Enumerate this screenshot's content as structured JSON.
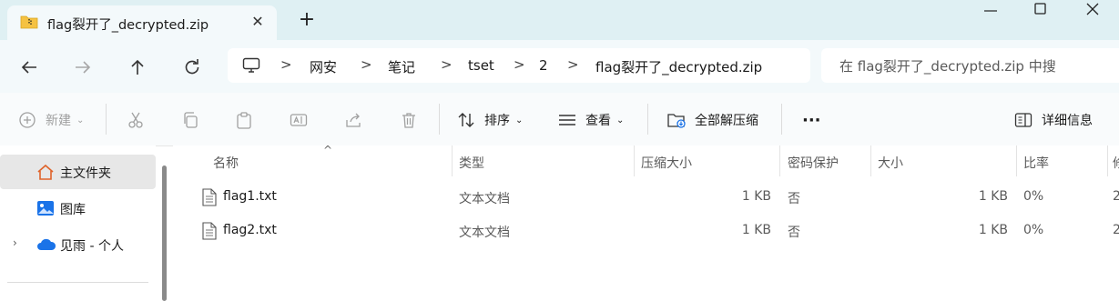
{
  "window": {
    "tab_title": "flag裂开了_decrypted.zip",
    "new_tab_label": "+",
    "close_tab_label": "✕",
    "minimize_label": "—",
    "maximize_label": "☐",
    "close_window_label": "✕"
  },
  "nav": {
    "back_label": "←",
    "forward_label": "→",
    "up_label": "↑",
    "refresh_label": "↻",
    "breadcrumb": [
      "网安",
      "笔记",
      "tset",
      "2",
      "flag裂开了_decrypted.zip"
    ],
    "separator": ">"
  },
  "search": {
    "placeholder": "在 flag裂开了_decrypted.zip 中搜"
  },
  "toolbar": {
    "new_label": "新建",
    "sort_label": "排序",
    "view_label": "查看",
    "extract_all_label": "全部解压缩",
    "more_label": "···",
    "details_label": "详细信息"
  },
  "sidebar": {
    "items": [
      {
        "label": "主文件夹",
        "icon": "home-icon"
      },
      {
        "label": "图库",
        "icon": "gallery-icon"
      },
      {
        "label": "见雨 - 个人",
        "icon": "onedrive-cloud-icon"
      }
    ]
  },
  "table": {
    "columns": [
      "名称",
      "类型",
      "压缩大小",
      "密码保护",
      "大小",
      "比率",
      "修"
    ],
    "rows": [
      {
        "name": "flag1.txt",
        "type": "文本文档",
        "compressed": "1 KB",
        "password": "否",
        "size": "1 KB",
        "ratio": "0%",
        "modified": "2"
      },
      {
        "name": "flag2.txt",
        "type": "文本文档",
        "compressed": "1 KB",
        "password": "否",
        "size": "1 KB",
        "ratio": "0%",
        "modified": "2"
      }
    ]
  },
  "colors": {
    "titlebar_bg": "#dff0f3",
    "nav_bg": "#f3f9fb",
    "selected_bg": "#e7e7e7",
    "zip_yellow": "#f5c242",
    "onedrive_blue": "#1a73e8"
  }
}
